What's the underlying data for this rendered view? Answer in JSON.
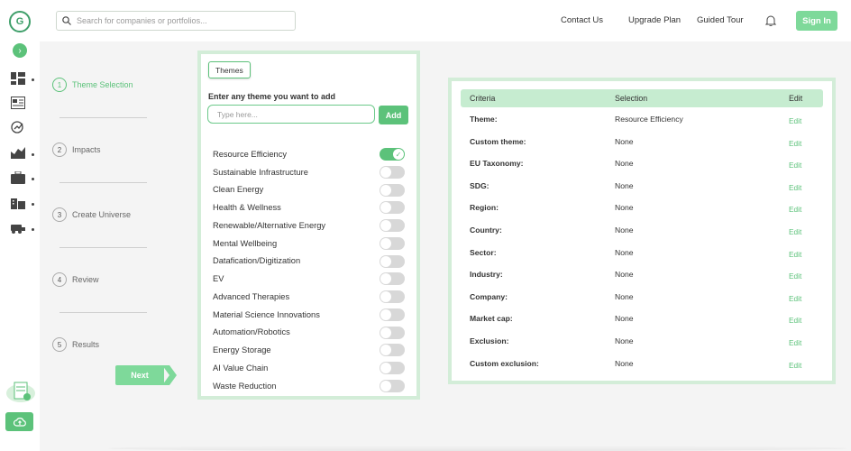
{
  "app": {
    "logo_text": "G"
  },
  "search": {
    "placeholder": "Search for companies or portfolios..."
  },
  "nav": {
    "contact": "Contact Us",
    "upgrade": "Upgrade Plan",
    "tour": "Guided Tour",
    "signin": "Sign In"
  },
  "steps": [
    {
      "num": "1",
      "label": "Theme Selection",
      "active": true
    },
    {
      "num": "2",
      "label": "Impacts",
      "active": false
    },
    {
      "num": "3",
      "label": "Create Universe",
      "active": false
    },
    {
      "num": "4",
      "label": "Review",
      "active": false
    },
    {
      "num": "5",
      "label": "Results",
      "active": false
    }
  ],
  "next_label": "Next",
  "themes": {
    "tab_label": "Themes",
    "prompt": "Enter any theme you want to add",
    "input_placeholder": "Type here...",
    "add_label": "Add",
    "items": [
      {
        "name": "Resource Efficiency",
        "on": true
      },
      {
        "name": "Sustainable Infrastructure",
        "on": false
      },
      {
        "name": "Clean Energy",
        "on": false
      },
      {
        "name": "Health & Wellness",
        "on": false
      },
      {
        "name": "Renewable/Alternative Energy",
        "on": false
      },
      {
        "name": "Mental Wellbeing",
        "on": false
      },
      {
        "name": "Datafication/Digitization",
        "on": false
      },
      {
        "name": "EV",
        "on": false
      },
      {
        "name": "Advanced Therapies",
        "on": false
      },
      {
        "name": "Material Science Innovations",
        "on": false
      },
      {
        "name": "Automation/Robotics",
        "on": false
      },
      {
        "name": "Energy Storage",
        "on": false
      },
      {
        "name": "AI Value Chain",
        "on": false
      },
      {
        "name": "Waste Reduction",
        "on": false
      }
    ]
  },
  "criteria": {
    "headers": {
      "criteria": "Criteria",
      "selection": "Selection",
      "edit": "Edit"
    },
    "rows": [
      {
        "label": "Theme:",
        "value": "Resource Efficiency",
        "edit": "Edit"
      },
      {
        "label": "Custom theme:",
        "value": "None",
        "edit": "Edit"
      },
      {
        "label": "EU Taxonomy:",
        "value": "None",
        "edit": "Edit"
      },
      {
        "label": "SDG:",
        "value": "None",
        "edit": "Edit"
      },
      {
        "label": "Region:",
        "value": "None",
        "edit": "Edit"
      },
      {
        "label": "Country:",
        "value": "None",
        "edit": "Edit"
      },
      {
        "label": "Sector:",
        "value": "None",
        "edit": "Edit"
      },
      {
        "label": "Industry:",
        "value": "None",
        "edit": "Edit"
      },
      {
        "label": "Company:",
        "value": "None",
        "edit": "Edit"
      },
      {
        "label": "Market cap:",
        "value": "None",
        "edit": "Edit"
      },
      {
        "label": "Exclusion:",
        "value": "None",
        "edit": "Edit"
      },
      {
        "label": "Custom exclusion:",
        "value": "None",
        "edit": "Edit"
      }
    ]
  },
  "colors": {
    "accent": "#5cc27a",
    "accent_light": "#7ed99a",
    "panel_border": "#d3edd8"
  }
}
